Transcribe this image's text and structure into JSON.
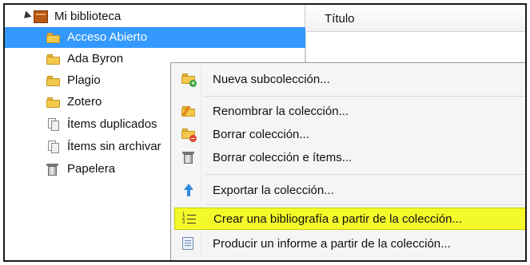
{
  "tree": {
    "library_label": "Mi biblioteca",
    "items": [
      {
        "label": "Acceso Abierto",
        "icon": "folder-icon",
        "selected": true
      },
      {
        "label": "Ada Byron",
        "icon": "folder-icon"
      },
      {
        "label": "Plagio",
        "icon": "folder-icon"
      },
      {
        "label": "Zotero",
        "icon": "folder-icon"
      },
      {
        "label": "Ítems duplicados",
        "icon": "duplicates-icon"
      },
      {
        "label": "Ítems sin archivar",
        "icon": "unfiled-icon"
      },
      {
        "label": "Papelera",
        "icon": "trash-icon"
      }
    ]
  },
  "items_pane": {
    "column_title": "Título"
  },
  "context_menu": {
    "items": [
      {
        "label": "Nueva subcolección...",
        "icon": "new-subcollection-icon"
      },
      {
        "label": "Renombrar la colección...",
        "icon": "rename-collection-icon"
      },
      {
        "label": "Borrar colección...",
        "icon": "delete-collection-icon"
      },
      {
        "label": "Borrar colección e ítems...",
        "icon": "delete-collection-items-icon"
      },
      {
        "label": "Exportar la colección...",
        "icon": "export-icon"
      },
      {
        "label": "Crear una bibliografía a partir de la colección...",
        "icon": "bibliography-icon",
        "highlighted": true
      },
      {
        "label": "Producir un informe a partir de la colección...",
        "icon": "report-icon"
      }
    ]
  },
  "colors": {
    "selection": "#3399ff",
    "highlight": "#f4f92a",
    "folder": "#f2c94c"
  }
}
